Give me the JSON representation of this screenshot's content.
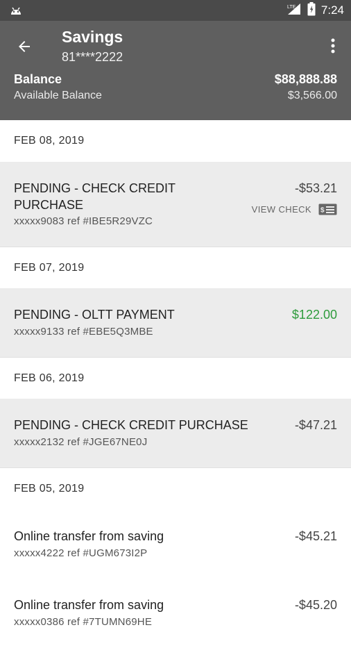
{
  "status_bar": {
    "time": "7:24",
    "network": "LTE"
  },
  "header": {
    "title": "Savings",
    "account_number": "81****2222",
    "balance_label": "Balance",
    "balance_value": "$88,888.88",
    "available_label": "Available Balance",
    "available_value": "$3,566.00"
  },
  "groups": [
    {
      "date": "FEB 08, 2019",
      "transactions": [
        {
          "description": "PENDING - CHECK CREDIT PURCHASE",
          "ref": "xxxxx9083 ref #IBE5R29VZC",
          "amount": "-$53.21",
          "action": "VIEW CHECK"
        }
      ]
    },
    {
      "date": "FEB 07, 2019",
      "transactions": [
        {
          "description": "PENDING - OLTT PAYMENT",
          "ref": "xxxxx9133 ref #EBE5Q3MBE",
          "amount": "$122.00"
        }
      ]
    },
    {
      "date": "FEB 06, 2019",
      "transactions": [
        {
          "description": "PENDING - CHECK CREDIT PURCHASE",
          "ref": "xxxxx2132 ref #JGE67NE0J",
          "amount": "-$47.21"
        }
      ]
    },
    {
      "date": "FEB 05, 2019",
      "transactions": [
        {
          "description": "Online transfer from saving",
          "ref": "xxxxx4222 ref #UGM673I2P",
          "amount": "-$45.21"
        },
        {
          "description": "Online transfer from saving",
          "ref": "xxxxx0386 ref #7TUMN69HE",
          "amount": "-$45.20"
        }
      ]
    }
  ],
  "colors": {
    "app_bar": "#5f5f5f",
    "status_bar": "#4a4a4a",
    "pending_row": "#ececec",
    "positive_amount": "#2e9b3c"
  }
}
